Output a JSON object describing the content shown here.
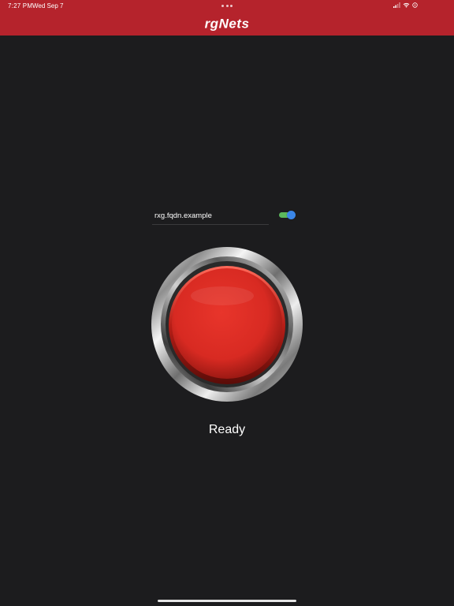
{
  "status_bar": {
    "time": "7:27 PM",
    "date": "Wed Sep 7"
  },
  "header": {
    "logo_text": "rgNets",
    "background": "#b5232c"
  },
  "server": {
    "value": "rxg.fqdn.example",
    "toggle_on": true,
    "toggle_track_color": "#5cb85c",
    "toggle_thumb_color": "#3a86e8"
  },
  "main_button": {
    "icon": "red-push-button-icon",
    "color": "#d82a22"
  },
  "status": {
    "label": "Ready"
  }
}
